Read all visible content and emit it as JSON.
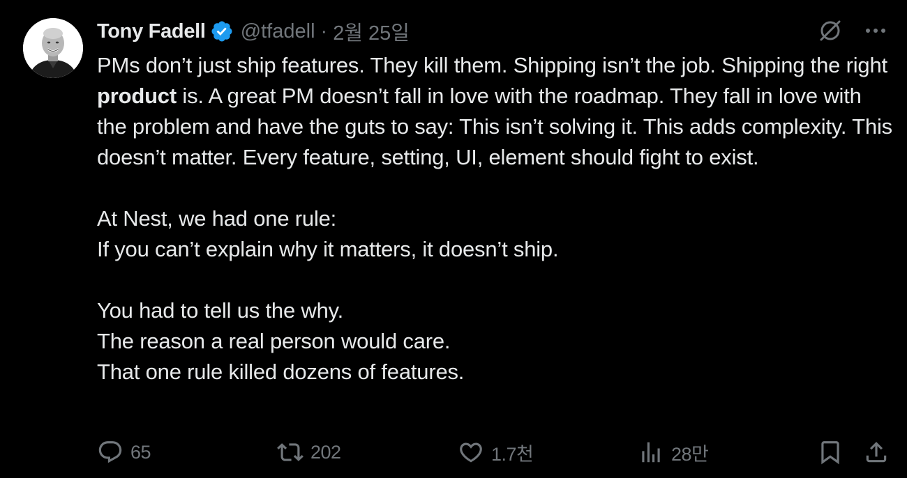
{
  "author": {
    "name": "Tony Fadell",
    "handle": "@tfadell",
    "separator": "·",
    "date": "2월 25일",
    "verified": true
  },
  "colors": {
    "background": "#000000",
    "text": "#e7e9ea",
    "muted": "#71767b",
    "verified_blue": "#1d9bf0"
  },
  "icons": {
    "top_right": [
      "grok-slash-icon",
      "more-icon"
    ],
    "actions": [
      "reply-icon",
      "retweet-icon",
      "like-icon",
      "views-icon",
      "bookmark-icon",
      "share-icon"
    ]
  },
  "tweet": {
    "p1_before": "PMs don’t just ship features. They kill them. Shipping isn’t the job. Shipping the right ",
    "p1_bold": "product",
    "p1_after": " is. A great PM doesn’t fall in love with the roadmap. They fall in love with the problem and have the guts to say: This isn’t solving it. This adds complexity. This doesn’t matter. Every feature, setting, UI, element should fight to exist.",
    "line2": "At Nest, we had one rule:",
    "line3": "If you can’t explain why it matters, it doesn’t ship.",
    "line4": "You had to tell us the why.",
    "line5": "The reason a real person would care.",
    "line6": "That one rule killed dozens of features."
  },
  "stats": {
    "replies": "65",
    "retweets": "202",
    "likes": "1.7천",
    "views": "28만"
  }
}
